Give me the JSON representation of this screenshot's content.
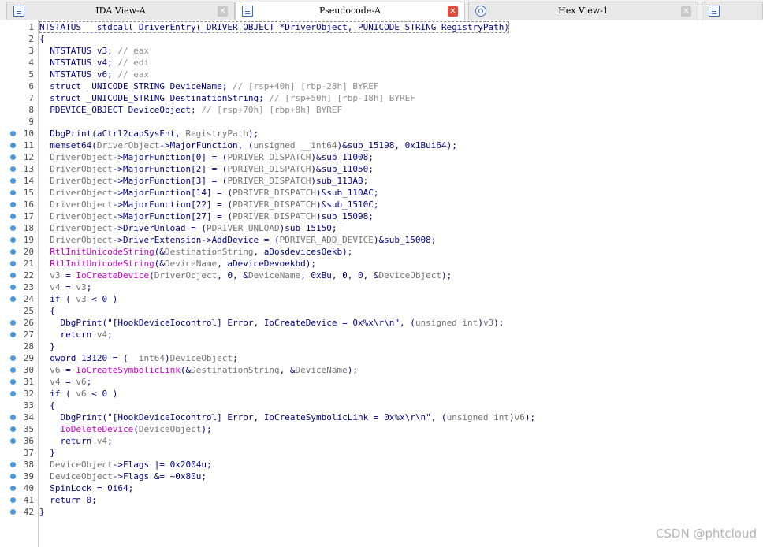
{
  "tabs": [
    {
      "label": "IDA View-A",
      "icon": "ida-view-icon",
      "active": false
    },
    {
      "label": "Pseudocode-A",
      "icon": "pseudocode-icon",
      "active": true
    },
    {
      "label": "Hex View-1",
      "icon": "hex-view-icon",
      "active": false
    }
  ],
  "code": {
    "lines": [
      {
        "n": "1",
        "bp": false,
        "tokens": [
          [
            "NTSTATUS __stdcall DriverEntry(_DRIVER_OBJECT *DriverObject, PUNICODE_STRING RegistryPath)",
            "kw"
          ]
        ]
      },
      {
        "n": "2",
        "bp": false,
        "tokens": [
          [
            "{",
            "kw"
          ]
        ]
      },
      {
        "n": "3",
        "bp": false,
        "tokens": [
          [
            "  NTSTATUS v3; ",
            "kw"
          ],
          [
            "// eax",
            "cmt"
          ]
        ]
      },
      {
        "n": "4",
        "bp": false,
        "tokens": [
          [
            "  NTSTATUS v4; ",
            "kw"
          ],
          [
            "// edi",
            "cmt"
          ]
        ]
      },
      {
        "n": "5",
        "bp": false,
        "tokens": [
          [
            "  NTSTATUS v6; ",
            "kw"
          ],
          [
            "// eax",
            "cmt"
          ]
        ]
      },
      {
        "n": "6",
        "bp": false,
        "tokens": [
          [
            "  struct _UNICODE_STRING DeviceName; ",
            "kw"
          ],
          [
            "// [rsp+40h] [rbp-28h] BYREF",
            "cmt"
          ]
        ]
      },
      {
        "n": "7",
        "bp": false,
        "tokens": [
          [
            "  struct _UNICODE_STRING DestinationString; ",
            "kw"
          ],
          [
            "// [rsp+50h] [rbp-18h] BYREF",
            "cmt"
          ]
        ]
      },
      {
        "n": "8",
        "bp": false,
        "tokens": [
          [
            "  PDEVICE_OBJECT DeviceObject; ",
            "kw"
          ],
          [
            "// [rsp+70h] [rbp+8h] BYREF",
            "cmt"
          ]
        ]
      },
      {
        "n": "9",
        "bp": false,
        "tokens": []
      },
      {
        "n": "10",
        "bp": true,
        "tokens": [
          [
            "  DbgPrint(aCtrl2capSysEnt, ",
            "kw"
          ],
          [
            "RegistryPath",
            "param"
          ],
          [
            ");",
            "kw"
          ]
        ]
      },
      {
        "n": "11",
        "bp": true,
        "tokens": [
          [
            "  memset64(",
            "kw"
          ],
          [
            "DriverObject",
            "param"
          ],
          [
            "->MajorFunction, (",
            "kw"
          ],
          [
            "unsigned __int64",
            "param"
          ],
          [
            ")&sub_15198, 0x1Bui64);",
            "kw"
          ]
        ]
      },
      {
        "n": "12",
        "bp": true,
        "tokens": [
          [
            "  ",
            "kw"
          ],
          [
            "DriverObject",
            "param"
          ],
          [
            "->MajorFunction[0] = (",
            "kw"
          ],
          [
            "PDRIVER_DISPATCH",
            "param"
          ],
          [
            ")&sub_11008;",
            "kw"
          ]
        ]
      },
      {
        "n": "13",
        "bp": true,
        "tokens": [
          [
            "  ",
            "kw"
          ],
          [
            "DriverObject",
            "param"
          ],
          [
            "->MajorFunction[2] = (",
            "kw"
          ],
          [
            "PDRIVER_DISPATCH",
            "param"
          ],
          [
            ")&sub_11050;",
            "kw"
          ]
        ]
      },
      {
        "n": "14",
        "bp": true,
        "tokens": [
          [
            "  ",
            "kw"
          ],
          [
            "DriverObject",
            "param"
          ],
          [
            "->MajorFunction[3] = (",
            "kw"
          ],
          [
            "PDRIVER_DISPATCH",
            "param"
          ],
          [
            ")sub_113A8;",
            "kw"
          ]
        ]
      },
      {
        "n": "15",
        "bp": true,
        "tokens": [
          [
            "  ",
            "kw"
          ],
          [
            "DriverObject",
            "param"
          ],
          [
            "->MajorFunction[14] = (",
            "kw"
          ],
          [
            "PDRIVER_DISPATCH",
            "param"
          ],
          [
            ")&sub_110AC;",
            "kw"
          ]
        ]
      },
      {
        "n": "16",
        "bp": true,
        "tokens": [
          [
            "  ",
            "kw"
          ],
          [
            "DriverObject",
            "param"
          ],
          [
            "->MajorFunction[22] = (",
            "kw"
          ],
          [
            "PDRIVER_DISPATCH",
            "param"
          ],
          [
            ")&sub_1510C;",
            "kw"
          ]
        ]
      },
      {
        "n": "17",
        "bp": true,
        "tokens": [
          [
            "  ",
            "kw"
          ],
          [
            "DriverObject",
            "param"
          ],
          [
            "->MajorFunction[27] = (",
            "kw"
          ],
          [
            "PDRIVER_DISPATCH",
            "param"
          ],
          [
            ")sub_15098;",
            "kw"
          ]
        ]
      },
      {
        "n": "18",
        "bp": true,
        "tokens": [
          [
            "  ",
            "kw"
          ],
          [
            "DriverObject",
            "param"
          ],
          [
            "->DriverUnload = (",
            "kw"
          ],
          [
            "PDRIVER_UNLOAD",
            "param"
          ],
          [
            ")sub_15150;",
            "kw"
          ]
        ]
      },
      {
        "n": "19",
        "bp": true,
        "tokens": [
          [
            "  ",
            "kw"
          ],
          [
            "DriverObject",
            "param"
          ],
          [
            "->DriverExtension->AddDevice = (",
            "kw"
          ],
          [
            "PDRIVER_ADD_DEVICE",
            "param"
          ],
          [
            ")&sub_15008;",
            "kw"
          ]
        ]
      },
      {
        "n": "20",
        "bp": true,
        "tokens": [
          [
            "  ",
            "kw"
          ],
          [
            "RtlInitUnicodeString",
            "imp"
          ],
          [
            "(&",
            "kw"
          ],
          [
            "DestinationString",
            "param"
          ],
          [
            ", aDosdevicesOekb);",
            "kw"
          ]
        ]
      },
      {
        "n": "21",
        "bp": true,
        "tokens": [
          [
            "  ",
            "kw"
          ],
          [
            "RtlInitUnicodeString",
            "imp"
          ],
          [
            "(&",
            "kw"
          ],
          [
            "DeviceName",
            "param"
          ],
          [
            ", aDeviceDevoekbd);",
            "kw"
          ]
        ]
      },
      {
        "n": "22",
        "bp": true,
        "tokens": [
          [
            "  ",
            "kw"
          ],
          [
            "v3",
            "param"
          ],
          [
            " = ",
            "kw"
          ],
          [
            "IoCreateDevice",
            "imp"
          ],
          [
            "(",
            "kw"
          ],
          [
            "DriverObject",
            "param"
          ],
          [
            ", 0, &",
            "kw"
          ],
          [
            "DeviceName",
            "param"
          ],
          [
            ", 0xBu, 0, 0, &",
            "kw"
          ],
          [
            "DeviceObject",
            "param"
          ],
          [
            ");",
            "kw"
          ]
        ]
      },
      {
        "n": "23",
        "bp": true,
        "tokens": [
          [
            "  ",
            "kw"
          ],
          [
            "v4",
            "param"
          ],
          [
            " = ",
            "kw"
          ],
          [
            "v3",
            "param"
          ],
          [
            ";",
            "kw"
          ]
        ]
      },
      {
        "n": "24",
        "bp": true,
        "tokens": [
          [
            "  if ( ",
            "kw"
          ],
          [
            "v3",
            "param"
          ],
          [
            " < 0 )",
            "kw"
          ]
        ]
      },
      {
        "n": "25",
        "bp": false,
        "tokens": [
          [
            "  {",
            "kw"
          ]
        ]
      },
      {
        "n": "26",
        "bp": true,
        "tokens": [
          [
            "    DbgPrint(\"[HookDeviceIocontrol] Error, IoCreateDevice = 0x%x\\r\\n\", (",
            "kw"
          ],
          [
            "unsigned int",
            "param"
          ],
          [
            ")",
            "kw"
          ],
          [
            "v3",
            "param"
          ],
          [
            ");",
            "kw"
          ]
        ]
      },
      {
        "n": "27",
        "bp": true,
        "tokens": [
          [
            "    return ",
            "kw"
          ],
          [
            "v4",
            "param"
          ],
          [
            ";",
            "kw"
          ]
        ]
      },
      {
        "n": "28",
        "bp": false,
        "tokens": [
          [
            "  }",
            "kw"
          ]
        ]
      },
      {
        "n": "29",
        "bp": true,
        "tokens": [
          [
            "  qword_13120 = (",
            "kw"
          ],
          [
            "__int64",
            "param"
          ],
          [
            ")",
            "kw"
          ],
          [
            "DeviceObject",
            "param"
          ],
          [
            ";",
            "kw"
          ]
        ]
      },
      {
        "n": "30",
        "bp": true,
        "tokens": [
          [
            "  ",
            "kw"
          ],
          [
            "v6",
            "param"
          ],
          [
            " = ",
            "kw"
          ],
          [
            "IoCreateSymbolicLink",
            "imp"
          ],
          [
            "(&",
            "kw"
          ],
          [
            "DestinationString",
            "param"
          ],
          [
            ", &",
            "kw"
          ],
          [
            "DeviceName",
            "param"
          ],
          [
            ");",
            "kw"
          ]
        ]
      },
      {
        "n": "31",
        "bp": true,
        "tokens": [
          [
            "  ",
            "kw"
          ],
          [
            "v4",
            "param"
          ],
          [
            " = ",
            "kw"
          ],
          [
            "v6",
            "param"
          ],
          [
            ";",
            "kw"
          ]
        ]
      },
      {
        "n": "32",
        "bp": true,
        "tokens": [
          [
            "  if ( ",
            "kw"
          ],
          [
            "v6",
            "param"
          ],
          [
            " < 0 )",
            "kw"
          ]
        ]
      },
      {
        "n": "33",
        "bp": false,
        "tokens": [
          [
            "  {",
            "kw"
          ]
        ]
      },
      {
        "n": "34",
        "bp": true,
        "tokens": [
          [
            "    DbgPrint(\"[HookDeviceIocontrol] Error, IoCreateSymbolicLink = 0x%x\\r\\n\", (",
            "kw"
          ],
          [
            "unsigned int",
            "param"
          ],
          [
            ")",
            "kw"
          ],
          [
            "v6",
            "param"
          ],
          [
            ");",
            "kw"
          ]
        ]
      },
      {
        "n": "35",
        "bp": true,
        "tokens": [
          [
            "    ",
            "kw"
          ],
          [
            "IoDeleteDevice",
            "imp"
          ],
          [
            "(",
            "kw"
          ],
          [
            "DeviceObject",
            "param"
          ],
          [
            ");",
            "kw"
          ]
        ]
      },
      {
        "n": "36",
        "bp": true,
        "tokens": [
          [
            "    return ",
            "kw"
          ],
          [
            "v4",
            "param"
          ],
          [
            ";",
            "kw"
          ]
        ]
      },
      {
        "n": "37",
        "bp": false,
        "tokens": [
          [
            "  }",
            "kw"
          ]
        ]
      },
      {
        "n": "38",
        "bp": true,
        "tokens": [
          [
            "  ",
            "kw"
          ],
          [
            "DeviceObject",
            "param"
          ],
          [
            "->Flags |= 0x2004u;",
            "kw"
          ]
        ]
      },
      {
        "n": "39",
        "bp": true,
        "tokens": [
          [
            "  ",
            "kw"
          ],
          [
            "DeviceObject",
            "param"
          ],
          [
            "->Flags &= ~0x80u;",
            "kw"
          ]
        ]
      },
      {
        "n": "40",
        "bp": true,
        "tokens": [
          [
            "  SpinLock = 0i64;",
            "kw"
          ]
        ]
      },
      {
        "n": "41",
        "bp": true,
        "tokens": [
          [
            "  return 0;",
            "kw"
          ]
        ]
      },
      {
        "n": "42",
        "bp": true,
        "tokens": [
          [
            "}",
            "kw"
          ]
        ]
      }
    ]
  },
  "watermark": "CSDN @phtcloud",
  "colors": {
    "keyword": "#000080",
    "identifier_gray": "#737373",
    "comment": "#8c8c8c",
    "import_function": "#c800c8",
    "breakpoint_dot": "#4b97df",
    "active_close": "#e04b3a"
  }
}
